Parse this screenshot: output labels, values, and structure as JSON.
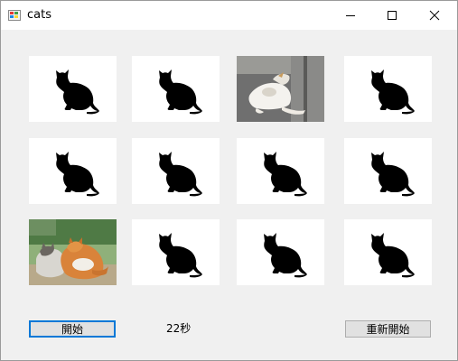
{
  "window": {
    "title": "cats",
    "icon": "app-icon"
  },
  "controls": {
    "minimize_icon": "minimize-icon",
    "maximize_icon": "maximize-icon",
    "close_icon": "close-icon"
  },
  "board": {
    "rows": 3,
    "cols": 4,
    "cards": [
      {
        "state": "hidden",
        "icon": "cat-silhouette-icon"
      },
      {
        "state": "hidden",
        "icon": "cat-silhouette-icon"
      },
      {
        "state": "revealed",
        "photo": "cat-lying-on-pavement-photo"
      },
      {
        "state": "hidden",
        "icon": "cat-silhouette-icon"
      },
      {
        "state": "hidden",
        "icon": "cat-silhouette-icon"
      },
      {
        "state": "hidden",
        "icon": "cat-silhouette-icon"
      },
      {
        "state": "hidden",
        "icon": "cat-silhouette-icon"
      },
      {
        "state": "hidden",
        "icon": "cat-silhouette-icon"
      },
      {
        "state": "revealed",
        "photo": "two-cats-on-grass-photo"
      },
      {
        "state": "hidden",
        "icon": "cat-silhouette-icon"
      },
      {
        "state": "hidden",
        "icon": "cat-silhouette-icon"
      },
      {
        "state": "hidden",
        "icon": "cat-silhouette-icon"
      }
    ]
  },
  "footer": {
    "start_label": "開始",
    "timer_text": "22秒",
    "restart_label": "重新開始"
  },
  "colors": {
    "focus_border": "#0078d7",
    "card_background": "#ffffff",
    "window_background": "#f0f0f0"
  }
}
